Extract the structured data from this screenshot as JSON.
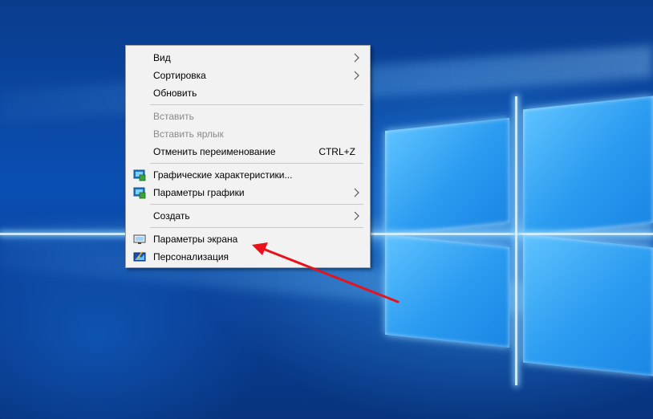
{
  "colors": {
    "menu_bg": "#f2f2f2",
    "menu_border": "#a0a0a0",
    "disabled_text": "#8a8a8a",
    "arrow_red": "#e8121a",
    "desktop_blue": "#0a4fb3"
  },
  "context_menu": {
    "items": [
      {
        "label": "Вид",
        "submenu": true
      },
      {
        "label": "Сортировка",
        "submenu": true
      },
      {
        "label": "Обновить"
      },
      {
        "label": "Вставить",
        "disabled": true
      },
      {
        "label": "Вставить ярлык",
        "disabled": true
      },
      {
        "label": "Отменить переименование",
        "shortcut": "CTRL+Z"
      },
      {
        "label": "Графические характеристики...",
        "icon": "intel-graphics-icon"
      },
      {
        "label": "Параметры графики",
        "icon": "intel-graphics-icon",
        "submenu": true
      },
      {
        "label": "Создать",
        "submenu": true
      },
      {
        "label": "Параметры экрана",
        "icon": "display-settings-icon"
      },
      {
        "label": "Персонализация",
        "icon": "personalization-icon"
      }
    ]
  },
  "annotation": {
    "type": "red-arrow",
    "target": "Параметры экрана"
  }
}
